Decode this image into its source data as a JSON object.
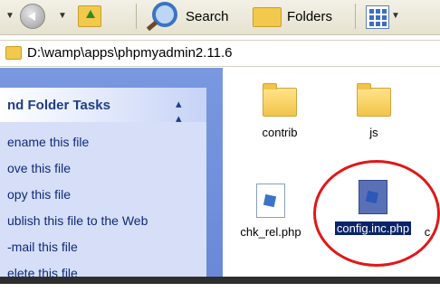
{
  "toolbar": {
    "back_icon": "back-arrow-icon",
    "forward_icon": "forward-dropdown-icon",
    "up_icon": "folder-up-icon",
    "search_label": "Search",
    "folders_label": "Folders",
    "views_icon": "views-icon"
  },
  "address": {
    "path": "D:\\wamp\\apps\\phpmyadmin2.11.6"
  },
  "tasks": {
    "title": "nd Folder Tasks",
    "collapse_symbol": "»",
    "items": [
      {
        "label": "ename this file"
      },
      {
        "label": "ove this file"
      },
      {
        "label": "opy this file"
      },
      {
        "label": "ublish this file to the Web"
      },
      {
        "label": "-mail this file"
      },
      {
        "label": "elete this file"
      }
    ]
  },
  "files": [
    {
      "name": "contrib",
      "type": "folder"
    },
    {
      "name": "js",
      "type": "folder"
    },
    {
      "name": "chk_rel.php",
      "type": "php"
    },
    {
      "name": "config.inc.php",
      "type": "php",
      "selected": true
    },
    {
      "name": "c",
      "type": "php"
    }
  ],
  "colors": {
    "selection": "#0a246a",
    "annotation_circle": "#e01818",
    "task_title": "#1f3d8a",
    "task_link": "#0f2a7a"
  }
}
